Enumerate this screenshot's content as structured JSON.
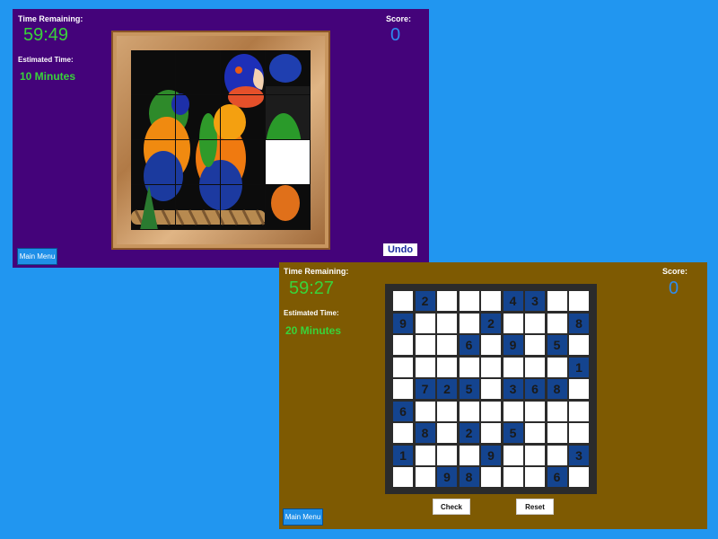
{
  "puzzle_game": {
    "time_remaining_label": "Time Remaining:",
    "time_remaining": "59:49",
    "estimated_time_label": "Estimated Time:",
    "estimated_time": "10 Minutes",
    "score_label": "Score:",
    "score": "0",
    "main_menu_label": "Main Menu",
    "undo_label": "Undo",
    "grid_size": 4,
    "empty_tile": {
      "row": 2,
      "col": 3
    },
    "image_subject": "parrot-photo"
  },
  "sudoku_game": {
    "time_remaining_label": "Time Remaining:",
    "time_remaining": "59:27",
    "estimated_time_label": "Estimated Time:",
    "estimated_time": "20 Minutes",
    "score_label": "Score:",
    "score": "0",
    "main_menu_label": "Main Menu",
    "check_label": "Check",
    "reset_label": "Reset",
    "grid": [
      [
        "",
        "2",
        "",
        "",
        "",
        "4",
        "3",
        "",
        ""
      ],
      [
        "9",
        "",
        "",
        "",
        "2",
        "",
        "",
        "",
        "8"
      ],
      [
        "",
        "",
        "",
        "6",
        "",
        "9",
        "",
        "5",
        ""
      ],
      [
        "",
        "",
        "",
        "",
        "",
        "",
        "",
        "",
        "1"
      ],
      [
        "",
        "7",
        "2",
        "5",
        "",
        "3",
        "6",
        "8",
        ""
      ],
      [
        "6",
        "",
        "",
        "",
        "",
        "",
        "",
        "",
        ""
      ],
      [
        "",
        "8",
        "",
        "2",
        "",
        "5",
        "",
        "",
        ""
      ],
      [
        "1",
        "",
        "",
        "",
        "9",
        "",
        "",
        "",
        "3"
      ],
      [
        "",
        "",
        "9",
        "8",
        "",
        "",
        "",
        "6",
        ""
      ]
    ]
  },
  "colors": {
    "background": "#2196f0",
    "puzzle_panel": "#44037a",
    "sudoku_panel": "#7e5a02",
    "timer_green": "#39d33a",
    "score_blue": "#2d8cf0",
    "given_cell": "#14448f"
  }
}
